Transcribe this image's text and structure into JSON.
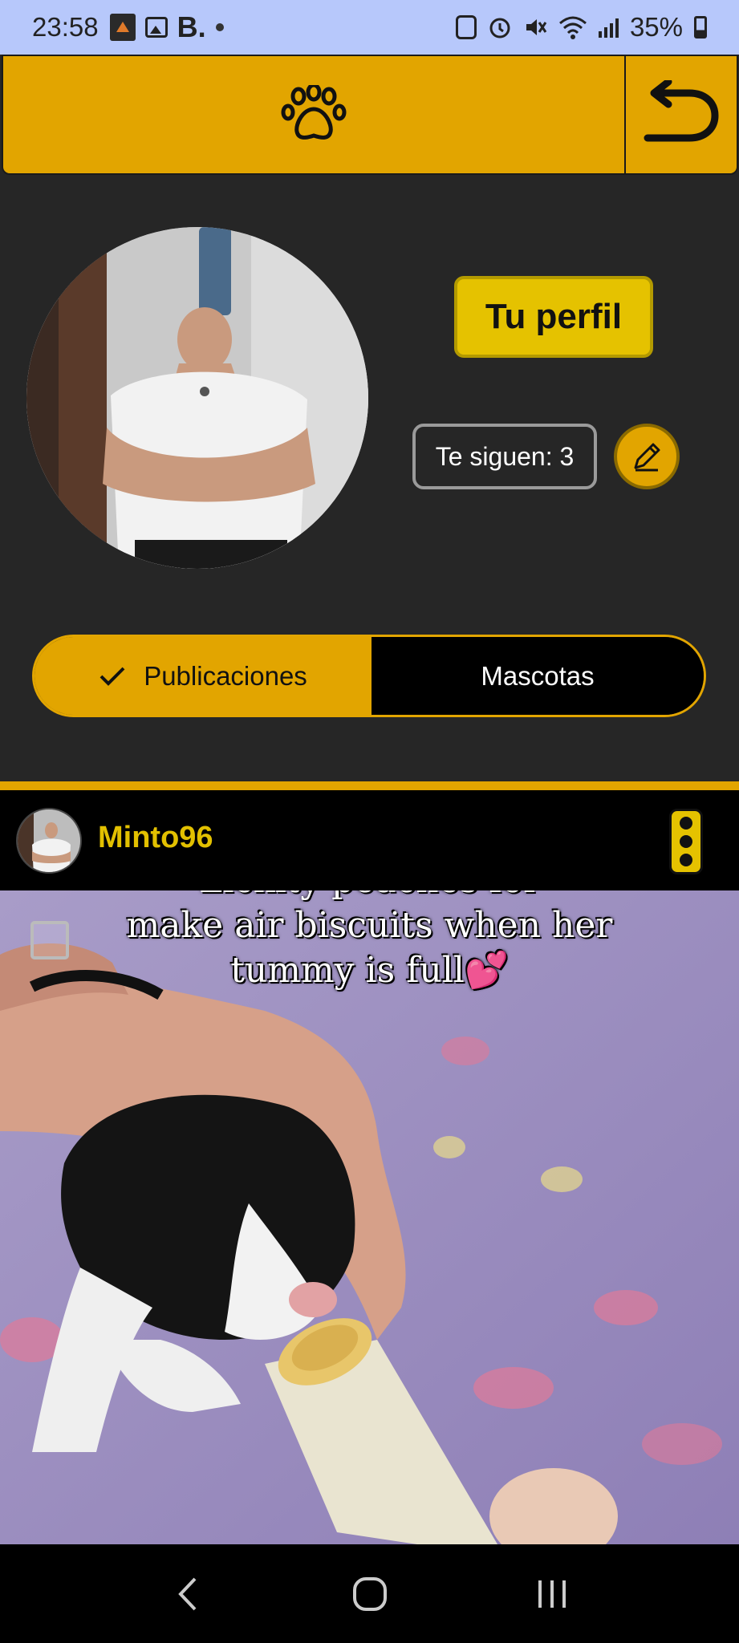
{
  "status_bar": {
    "time": "23:58",
    "battery": "35%",
    "left_icons": [
      "app-notification-icon",
      "gallery-icon",
      "b-app-icon",
      "dot-icon"
    ],
    "right_icons": [
      "nfc-icon",
      "alarm-icon",
      "mute-icon",
      "wifi-icon",
      "signal-icon",
      "battery-icon"
    ],
    "b_label": "B."
  },
  "app_bar": {
    "center_icon": "paw-icon",
    "back_icon": "back-arrow-icon",
    "accent": "#e2a500"
  },
  "profile": {
    "title_button": "Tu perfil",
    "followers": "Te siguen: 3",
    "edit_icon": "pencil-icon"
  },
  "tabs": {
    "selected": "Publicaciones",
    "other": "Mascotas"
  },
  "post": {
    "username": "Minto96",
    "caption_line1": "make air biscuits when her",
    "caption_line2": "tummy is full💕",
    "caption_cut": "Lickity peaches for"
  },
  "colors": {
    "accent": "#e2a500",
    "button_yellow": "#e5c200",
    "background": "#262626",
    "status_bar": "#b7c8fb"
  }
}
